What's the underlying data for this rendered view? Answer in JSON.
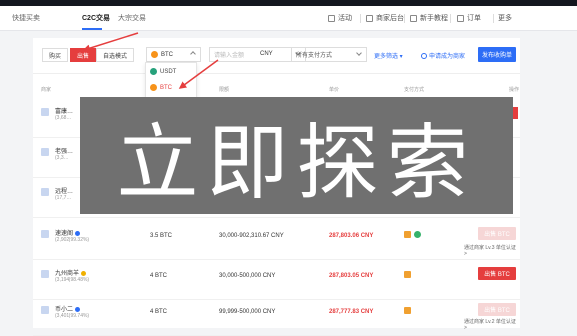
{
  "nav": {
    "tabs": [
      "快捷买卖",
      "C2C交易",
      "大宗交易"
    ],
    "active_tab": "C2C交易",
    "right_items": [
      "活动",
      "商家后台",
      "新手教程",
      "订单",
      "更多"
    ]
  },
  "filter": {
    "buy_label": "购买",
    "sell_label": "出售",
    "mode_label": "自选模式",
    "coin_selected": "BTC",
    "amount_placeholder": "请输入金额",
    "currency": "CNY",
    "payment_placeholder": "所有支付方式",
    "more_filter": "更多筛选",
    "apply_merchant": "申请成为商家",
    "publish": "发布收购单"
  },
  "dropdown": {
    "options": [
      "USDT",
      "BTC"
    ],
    "selected": "BTC"
  },
  "table": {
    "headers": [
      "商家",
      "数量",
      "限额",
      "单价",
      "支付方式",
      "操作"
    ],
    "rows": [
      {
        "name": "富康…",
        "stats": "(3,68…",
        "qty": "",
        "limit": "",
        "price": "",
        "action": "",
        "req": ""
      },
      {
        "name": "老强…",
        "stats": "(3,3…",
        "qty": "",
        "limit": "",
        "price": "",
        "action": "",
        "req": ""
      },
      {
        "name": "远程…",
        "stats": "(17,7…",
        "qty": "",
        "limit": "",
        "price": "",
        "action": "",
        "req": ""
      },
      {
        "name": "速速阁",
        "stats": "(2,902|99.32%)",
        "qty": "3.5 BTC",
        "limit": "30,000-902,310.67 CNY",
        "price": "287,803.06 CNY",
        "action": "出售 BTC",
        "req": "通过商家 Lv.3 单位认证 >"
      },
      {
        "name": "九州商羊",
        "stats": "(3,194|98.48%)",
        "qty": "4 BTC",
        "limit": "30,000-500,000 CNY",
        "price": "287,803.05 CNY",
        "action": "出售 BTC",
        "req": ""
      },
      {
        "name": "币小二",
        "stats": "(3,401|99.74%)",
        "qty": "4 BTC",
        "limit": "99,999-500,000 CNY",
        "price": "287,777.83 CNY",
        "action": "出售 BTC",
        "req": "通过商家 Lv.2 单位认证 >"
      }
    ]
  },
  "overlay_text": "立即探索",
  "colors": {
    "accent": "#2d6df6",
    "sell": "#e53e3e",
    "overlay": "#707070"
  }
}
